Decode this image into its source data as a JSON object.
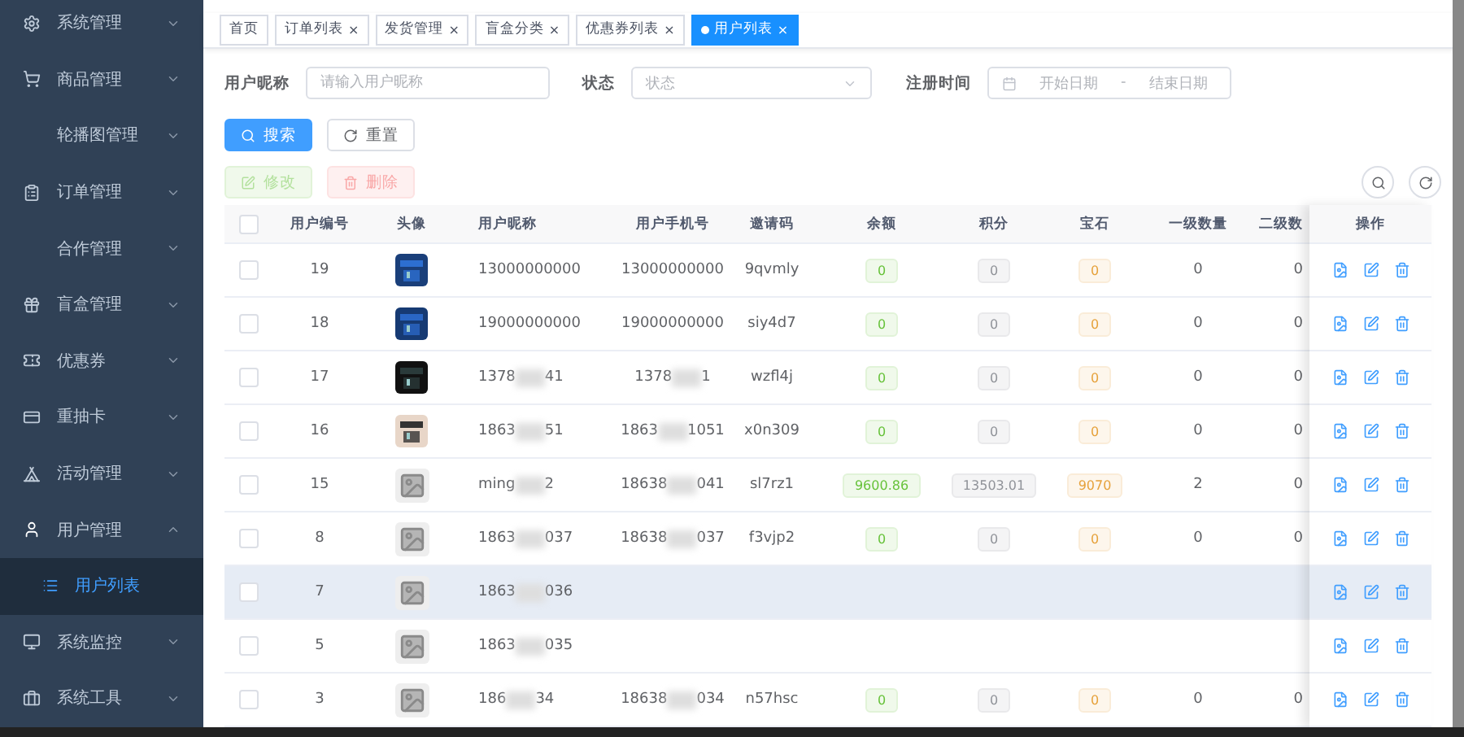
{
  "sidebar": {
    "items": [
      {
        "label": "系统管理",
        "expanded": false
      },
      {
        "label": "商品管理",
        "expanded": false
      },
      {
        "label": "轮播图管理",
        "expanded": false
      },
      {
        "label": "订单管理",
        "expanded": false
      },
      {
        "label": "合作管理",
        "expanded": false
      },
      {
        "label": "盲盒管理",
        "expanded": false
      },
      {
        "label": "优惠券",
        "expanded": false
      },
      {
        "label": "重抽卡",
        "expanded": false
      },
      {
        "label": "活动管理",
        "expanded": false
      },
      {
        "label": "用户管理",
        "expanded": true,
        "children": [
          {
            "label": "用户列表",
            "selected": true
          }
        ]
      },
      {
        "label": "系统监控",
        "expanded": false
      },
      {
        "label": "系统工具",
        "expanded": false
      }
    ]
  },
  "tags": [
    {
      "label": "首页",
      "selected": false
    },
    {
      "label": "订单列表",
      "selected": false,
      "close": "×"
    },
    {
      "label": "发货管理",
      "selected": false,
      "close": "×"
    },
    {
      "label": "盲盒分类",
      "selected": false,
      "close": "×"
    },
    {
      "label": "优惠券列表",
      "selected": false,
      "close": "×"
    },
    {
      "label": "用户列表",
      "selected": true,
      "close": "×"
    }
  ],
  "filters": {
    "nickname": {
      "label": "用户昵称",
      "placeholder": "请输入用户昵称"
    },
    "status": {
      "label": "状态",
      "placeholder": "状态"
    },
    "register_time": {
      "label": "注册时间",
      "start_placeholder": "开始日期",
      "separator": "-",
      "end_placeholder": "结束日期"
    }
  },
  "buttons": {
    "search": "搜索",
    "reset": "重置",
    "edit": {
      "label": "修改",
      "disabled": true
    },
    "delete": {
      "label": "删除",
      "disabled": true
    }
  },
  "table": {
    "all_checked": false,
    "columns": [
      "用户编号",
      "头像",
      "用户昵称",
      "用户手机号",
      "邀请码",
      "余额",
      "积分",
      "宝石",
      "一级数量",
      "二级数",
      "操作"
    ],
    "rows": [
      {
        "id": "19",
        "checked": false,
        "nickname": {
          "head": "13000000000"
        },
        "phone": {
          "head": "13000000000"
        },
        "code": "9qvmly",
        "balance": "0",
        "points": "0",
        "gems": "0",
        "first": "0",
        "second": "0",
        "highlighted": false
      },
      {
        "id": "18",
        "checked": false,
        "nickname": {
          "head": "19000000000"
        },
        "phone": {
          "head": "19000000000"
        },
        "code": "siy4d7",
        "balance": "0",
        "points": "0",
        "gems": "0",
        "first": "0",
        "second": "0",
        "highlighted": false
      },
      {
        "id": "17",
        "checked": false,
        "nickname": {
          "head": "1378",
          "tail": "41"
        },
        "phone": {
          "head": "1378",
          "tail": "1"
        },
        "code": "wzfl4j",
        "balance": "0",
        "points": "0",
        "gems": "0",
        "first": "0",
        "second": "0",
        "highlighted": false
      },
      {
        "id": "16",
        "checked": false,
        "nickname": {
          "head": "1863",
          "tail": "51"
        },
        "phone": {
          "head": "1863",
          "tail": "1051"
        },
        "code": "x0n309",
        "balance": "0",
        "points": "0",
        "gems": "0",
        "first": "0",
        "second": "0",
        "highlighted": false
      },
      {
        "id": "15",
        "checked": false,
        "avatar": {
          "kind": "placeholder"
        },
        "nickname": {
          "head": "ming",
          "tail": "2"
        },
        "phone": {
          "head": "18638",
          "tail": "041"
        },
        "code": "sl7rz1",
        "balance": "9600.86",
        "points": "13503.01",
        "gems": "9070",
        "first": "2",
        "second": "0",
        "highlighted": false
      },
      {
        "id": "8",
        "checked": false,
        "avatar": {
          "kind": "placeholder"
        },
        "nickname": {
          "head": "1863",
          "tail": "037"
        },
        "phone": {
          "head": "18638",
          "tail": "037"
        },
        "code": "f3vjp2",
        "balance": "0",
        "points": "0",
        "gems": "0",
        "first": "0",
        "second": "0",
        "highlighted": false
      },
      {
        "id": "7",
        "checked": false,
        "avatar": {
          "kind": "placeholder"
        },
        "nickname": {
          "head": "1863",
          "tail": "036"
        },
        "highlighted": true
      },
      {
        "id": "5",
        "checked": false,
        "avatar": {
          "kind": "placeholder"
        },
        "nickname": {
          "head": "1863",
          "tail": "035"
        },
        "highlighted": false
      },
      {
        "id": "3",
        "checked": false,
        "avatar": {
          "kind": "placeholder"
        },
        "nickname": {
          "head": "186",
          "tail": "34"
        },
        "phone": {
          "head": "18638",
          "tail": "034"
        },
        "code": "n57hsc",
        "balance": "0",
        "points": "0",
        "gems": "0",
        "first": "0",
        "second": "0",
        "highlighted": false
      }
    ]
  }
}
